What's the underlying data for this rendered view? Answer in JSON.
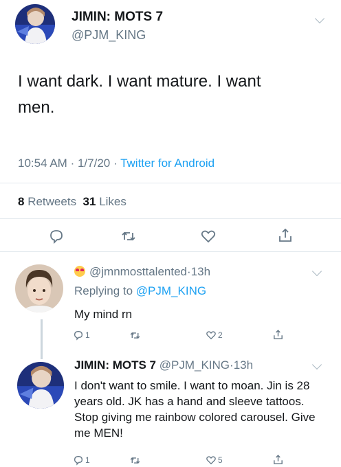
{
  "main_tweet": {
    "display_name": "JIMIN: MOTS 7",
    "handle": "@PJM_KING",
    "text_line1": "I want dark. I want mature. I want",
    "text_line2": "men.",
    "time": "10:54 AM",
    "date": "1/7/20",
    "source": "Twitter for Android",
    "retweets_count": "8",
    "retweets_label": "Retweets",
    "likes_count": "31",
    "likes_label": "Likes"
  },
  "reply1": {
    "handle": "@jmnmosttalented",
    "time": "13h",
    "replying_prefix": "Replying to",
    "replying_to": "@PJM_KING",
    "text": "My mind rn",
    "reply_count": "1",
    "like_count": "2"
  },
  "reply2": {
    "display_name": "JIMIN: MOTS 7",
    "handle": "@PJM_KING",
    "time": "13h",
    "text": "I don't want to smile. I want to moan. Jin is 28 years old. JK has a hand and sleeve tattoos. Stop giving me rainbow colored carousel. Give me MEN!",
    "reply_count": "1",
    "like_count": "5"
  },
  "separator": "·",
  "colors": {
    "accent": "#1da1f2",
    "muted": "#657786",
    "text": "#14171a",
    "divider": "#e1e8ed"
  }
}
